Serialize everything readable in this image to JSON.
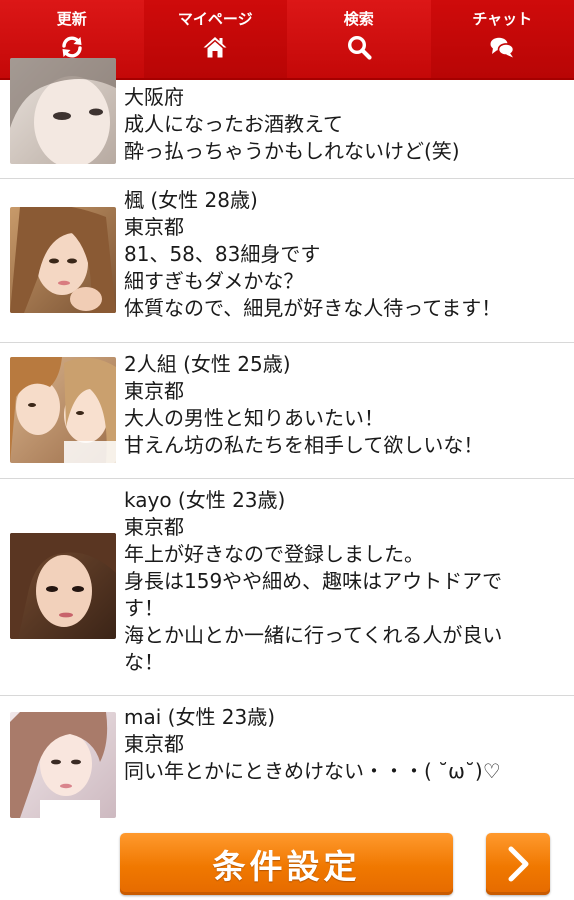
{
  "nav": {
    "items": [
      {
        "label": "更新",
        "icon": "refresh-icon"
      },
      {
        "label": "マイページ",
        "icon": "home-icon"
      },
      {
        "label": "検索",
        "icon": "search-icon"
      },
      {
        "label": "チャット",
        "icon": "chat-icon"
      }
    ],
    "colors": {
      "bar": "#d20d0d",
      "text": "#ffffff"
    }
  },
  "profiles": [
    {
      "header": "",
      "location": "大阪府",
      "message": [
        "成人になったお酒教えて",
        "酔っ払っちゃうかもしれないけど(笑)"
      ]
    },
    {
      "header": "楓 (女性 28歳)",
      "location": "東京都",
      "message": [
        "81、58、83細身です",
        "細すぎもダメかな？",
        "体質なので、細見が好きな人待ってます！"
      ]
    },
    {
      "header": "2人組 (女性 25歳)",
      "location": "東京都",
      "message": [
        "大人の男性と知りあいたい！",
        "甘えん坊の私たちを相手して欲しいな！"
      ]
    },
    {
      "header": "kayo (女性 23歳)",
      "location": "東京都",
      "message": [
        "年上が好きなので登録しました。",
        "身長は159やや細め、趣味はアウトドアで",
        "す！",
        "海とか山とか一緒に行ってくれる人が良い",
        "な！"
      ]
    },
    {
      "header": "mai (女性 23歳)",
      "location": "東京都",
      "message": [
        "同い年とかにときめけない・・・( ˘ω˘)♡"
      ]
    }
  ],
  "footer": {
    "condition_button": "条件設定",
    "next_icon": "chevron-right-icon",
    "accent": "#f07800"
  }
}
